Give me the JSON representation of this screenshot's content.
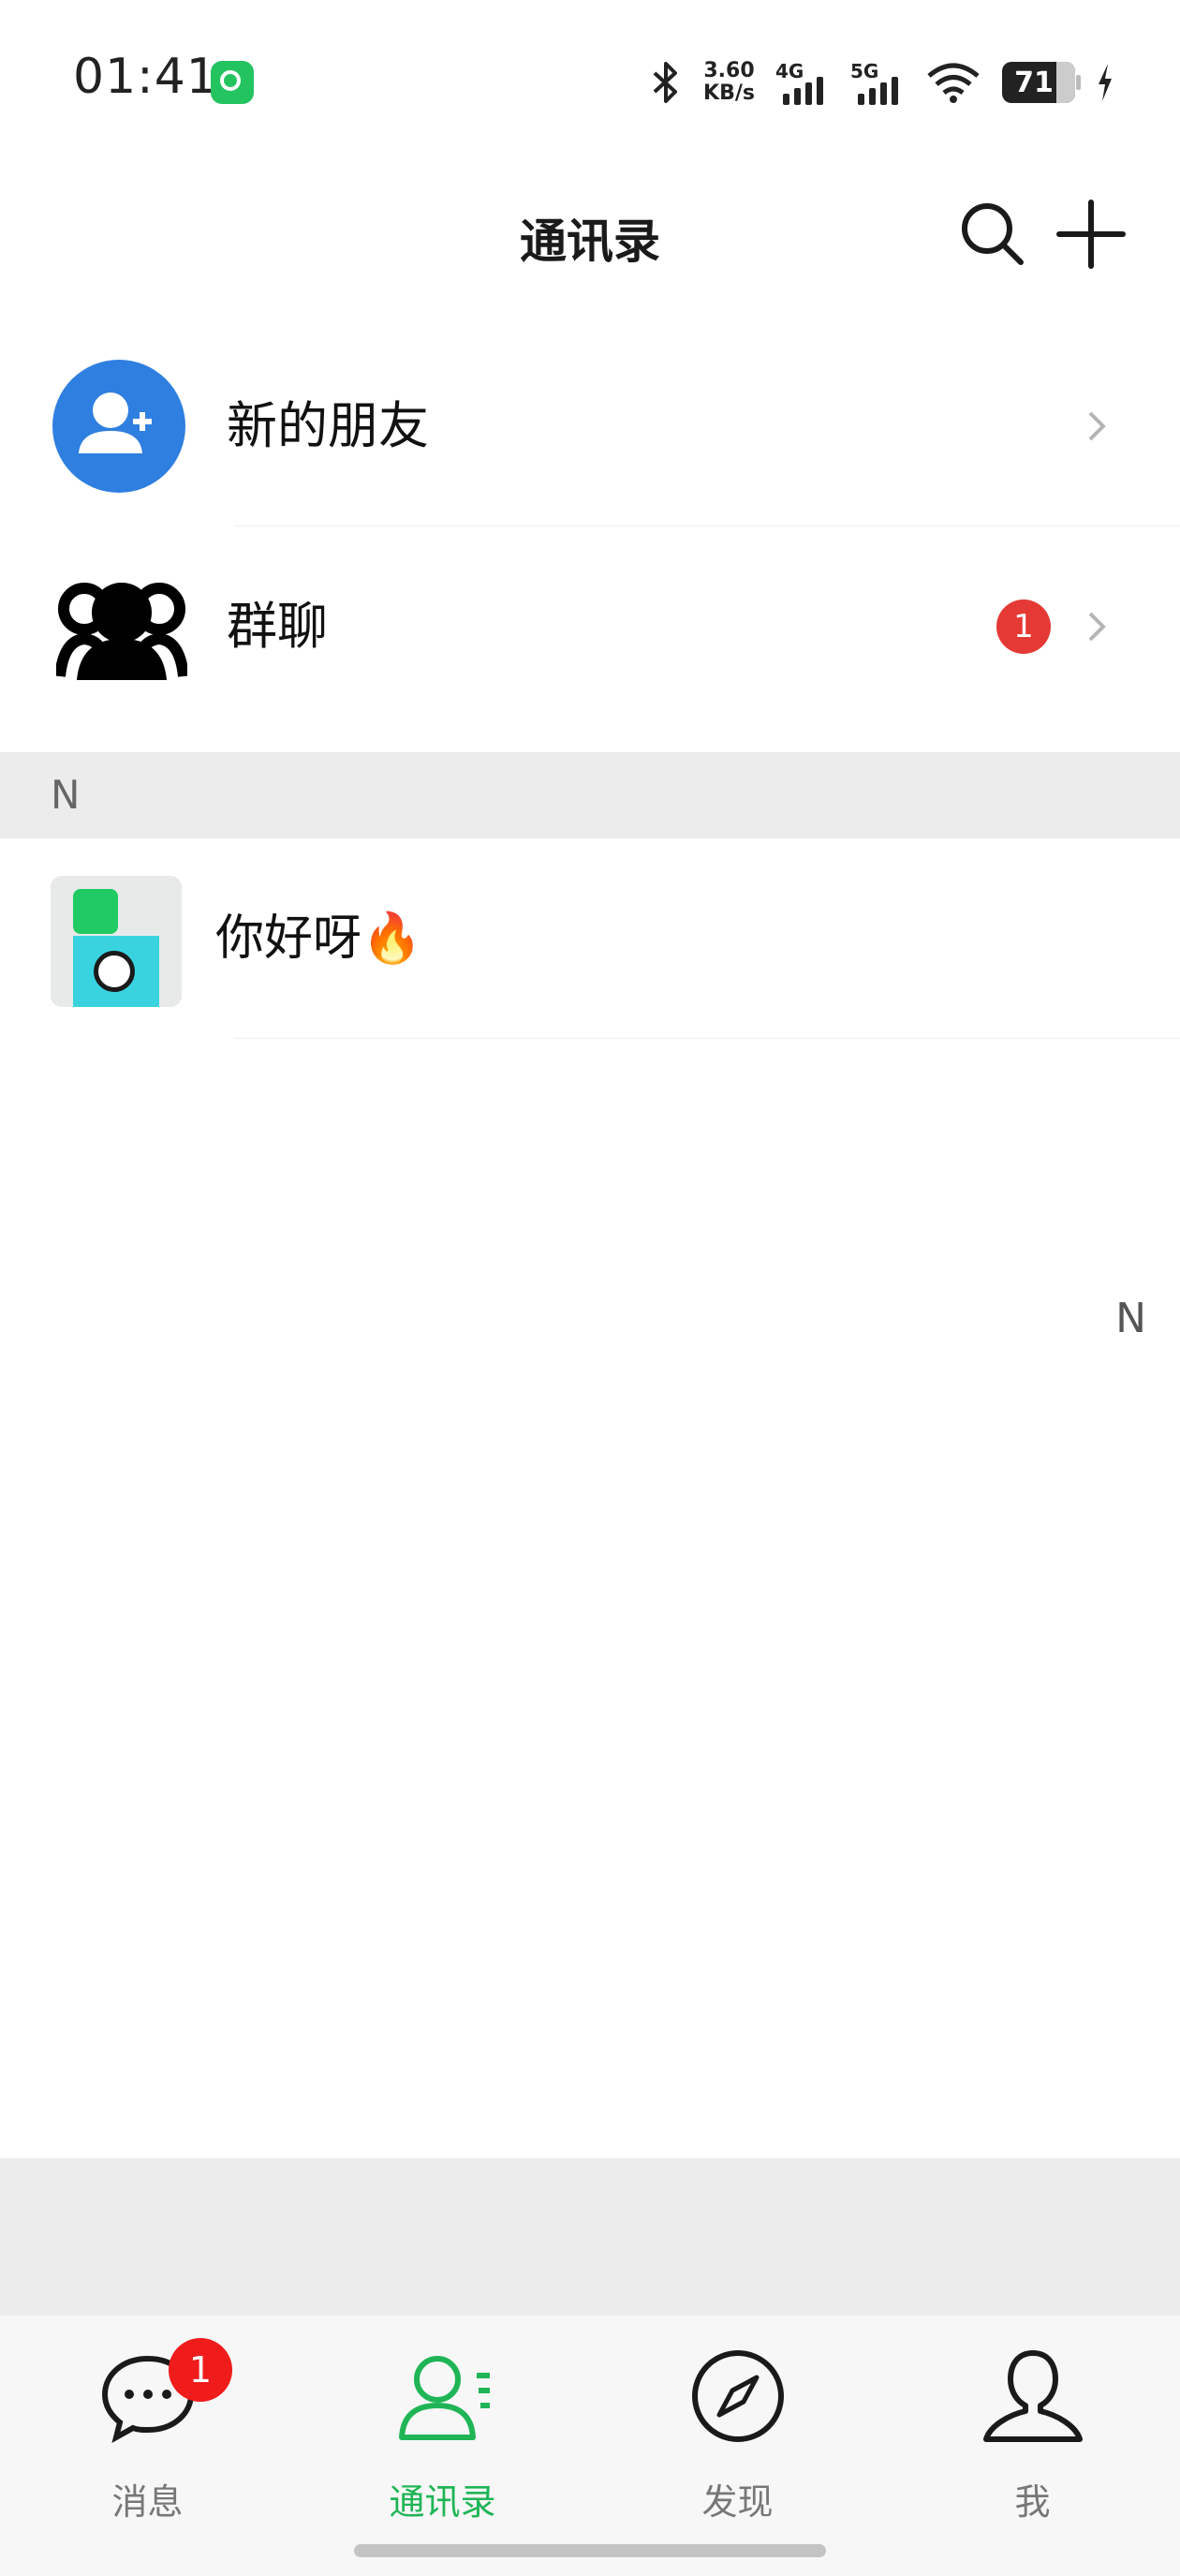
{
  "status_bar": {
    "time": "01:41",
    "speed_value": "3.60",
    "speed_unit": "KB/s",
    "net1": "4G",
    "net2": "5G",
    "battery": "71"
  },
  "header": {
    "title": "通讯录",
    "search_icon": "search-icon",
    "add_icon": "plus-icon"
  },
  "shortcuts": [
    {
      "label": "新的朋友",
      "icon": "add-friend-icon",
      "accent": "#2f7fe0"
    },
    {
      "label": "群聊",
      "icon": "group-chat-icon",
      "badge": "1"
    }
  ],
  "section": {
    "letter": "N"
  },
  "contacts": [
    {
      "name": "你好呀🔥"
    }
  ],
  "index_bar": {
    "letter": "N"
  },
  "tabs": [
    {
      "label": "消息",
      "icon": "chat-bubble-icon",
      "badge": "1",
      "active": false
    },
    {
      "label": "通讯录",
      "icon": "contacts-icon",
      "active": true
    },
    {
      "label": "发现",
      "icon": "compass-icon",
      "active": false
    },
    {
      "label": "我",
      "icon": "person-icon",
      "active": false
    }
  ],
  "colors": {
    "active": "#1fb556",
    "badge": "#e53935"
  }
}
